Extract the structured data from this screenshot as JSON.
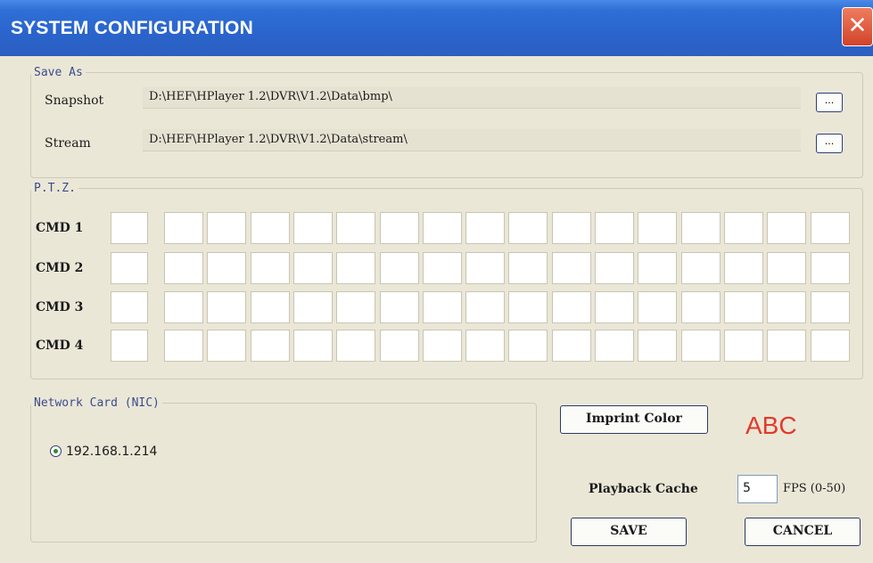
{
  "window": {
    "title": "SYSTEM CONFIGURATION",
    "close_icon": "close-icon",
    "close_glyph": "✕"
  },
  "save_as": {
    "legend": "Save As",
    "snapshot_label": "Snapshot",
    "snapshot_path": "D:\\HEF\\HPlayer 1.2\\DVR\\V1.2\\Data\\bmp\\",
    "stream_label": "Stream",
    "stream_path": "D:\\HEF\\HPlayer 1.2\\DVR\\V1.2\\Data\\stream\\",
    "browse_label": "..."
  },
  "ptz": {
    "legend": "P.T.Z.",
    "commands": [
      "CMD 1",
      "CMD 2",
      "CMD 3",
      "CMD 4"
    ]
  },
  "network": {
    "legend": "Network Card (NIC)",
    "ip": "192.168.1.214",
    "selected": true
  },
  "imprint": {
    "button_label": "Imprint Color",
    "sample_text": "ABC",
    "sample_color": "#e23b2a"
  },
  "playback": {
    "label": "Playback Cache",
    "value": "5",
    "unit": "FPS (0-50)"
  },
  "actions": {
    "save": "SAVE",
    "cancel": "CANCEL"
  }
}
